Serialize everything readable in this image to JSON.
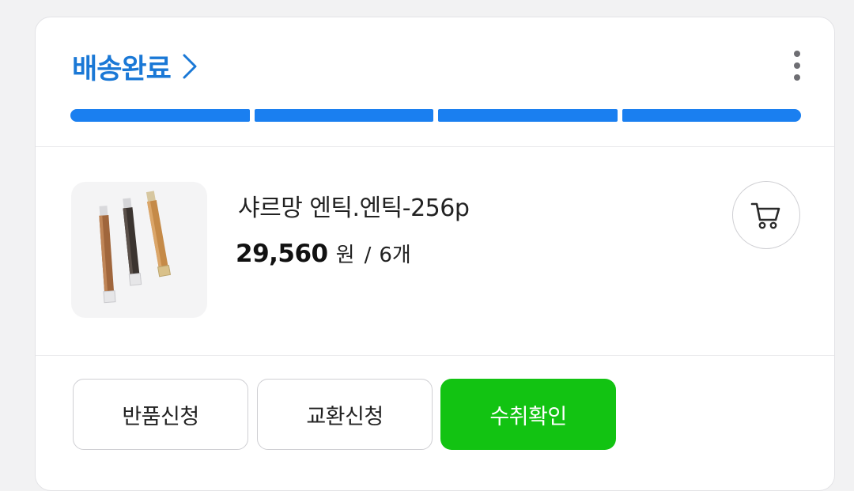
{
  "order": {
    "status_label": "배송완료",
    "progress": {
      "steps_total": 4,
      "steps_completed": 4
    },
    "colors": {
      "status_text": "#1a78d6",
      "progress_fill": "#1a7ff0",
      "confirm_button": "#12c312"
    }
  },
  "product": {
    "name": "샤르망 엔틱.엔틱-256p",
    "price": "29,560",
    "currency": "원",
    "separator": "/",
    "quantity": "6개",
    "thumbnail": "curtain-rod-product-image"
  },
  "icons": {
    "status_link": "chevron-right-icon",
    "more": "more-vertical-icon",
    "cart": "cart-icon"
  },
  "actions": {
    "return_label": "반품신청",
    "exchange_label": "교환신청",
    "confirm_label": "수취확인"
  }
}
